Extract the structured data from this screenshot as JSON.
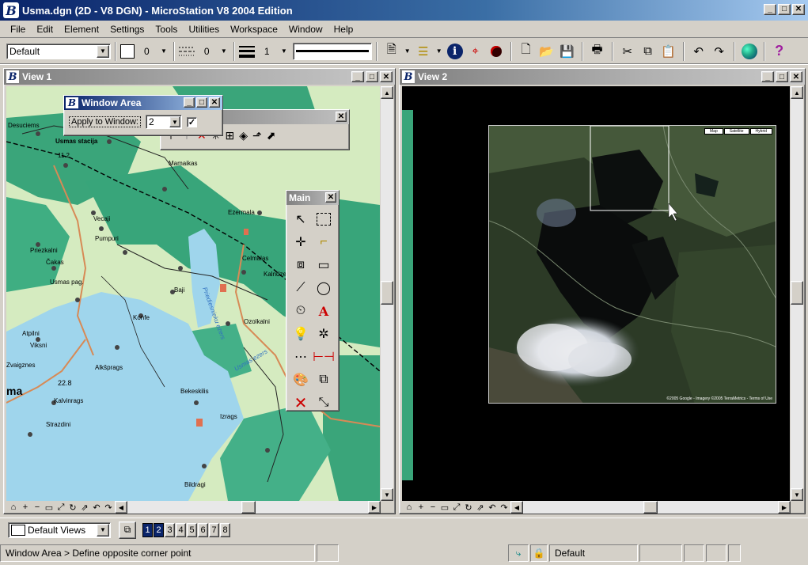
{
  "app": {
    "title": "Usma.dgn (2D - V8 DGN) - MicroStation V8 2004 Edition",
    "logo_letter": "B"
  },
  "menu": [
    {
      "label": "File",
      "key": "F"
    },
    {
      "label": "Edit",
      "key": "E"
    },
    {
      "label": "Element",
      "key": "E"
    },
    {
      "label": "Settings",
      "key": "S"
    },
    {
      "label": "Tools",
      "key": "T"
    },
    {
      "label": "Utilities",
      "key": "U"
    },
    {
      "label": "Workspace",
      "key": "W"
    },
    {
      "label": "Window",
      "key": "W"
    },
    {
      "label": "Help",
      "key": "H"
    }
  ],
  "attributes": {
    "level": "Default",
    "color": "0",
    "style": "0",
    "weight": "1"
  },
  "toolbar_icons": [
    "new-file-icon",
    "level-manager-icon",
    "info-icon",
    "select-icon",
    "record-icon",
    "new-icon",
    "open-icon",
    "save-icon",
    "print-icon",
    "cut-icon",
    "copy-icon",
    "paste-icon",
    "undo-icon",
    "redo-icon",
    "globe-icon",
    "help-icon"
  ],
  "view1": {
    "title": "View 1"
  },
  "view2": {
    "title": "View 2"
  },
  "window_area": {
    "title": "Window Area",
    "apply_label": "Apply to Window:",
    "window_value": "2",
    "checked": true
  },
  "main_palette": {
    "title": "Main"
  },
  "map_labels": {
    "desuciems": "Desuciems",
    "usmas_stacija": "Usmas stacija",
    "vecaji": "Vecaji",
    "pumpuri": "Pumpuri",
    "priezkalni": "Priezkalni",
    "cakas": "Čakas",
    "celmalas": "Celmalas",
    "ezermala": "Ezermala",
    "usmas_pag": "Usmas pag.",
    "kalndzeni": "Kalndzeni",
    "ozolkalni": "Ozolkalni",
    "baji": "Baji",
    "konfe": "Konfe",
    "atpilni": "Atpilni",
    "viksni": "Viksni",
    "zvaigznes": "Zvaigznes",
    "alkaspr": "Alkšprags",
    "kalvinrags": "Kalvinrags",
    "strazdini": "Strazdini",
    "bekeskilis": "Bekeskilis",
    "izrags": "Izrags",
    "bildragi": "Bildragi",
    "mamaikas": "Mamaikas",
    "ma": "ma",
    "elev1": "11.2",
    "elev2": "22.8",
    "lake_upper": "Priediesnieku ezers",
    "lake_lower": "Usmas ezers"
  },
  "sat_tabs": [
    "Map",
    "Satellite",
    "Hybrid"
  ],
  "sat_credit": "©2005 Google - Imagery ©2005 TerraMetrics - Terms of Use",
  "view_group": {
    "label": "Default Views",
    "views": [
      "1",
      "2",
      "3",
      "4",
      "5",
      "6",
      "7",
      "8"
    ],
    "active": [
      "1",
      "2"
    ]
  },
  "status": {
    "prompt": "Window Area > Define opposite corner point",
    "level": "Default"
  }
}
